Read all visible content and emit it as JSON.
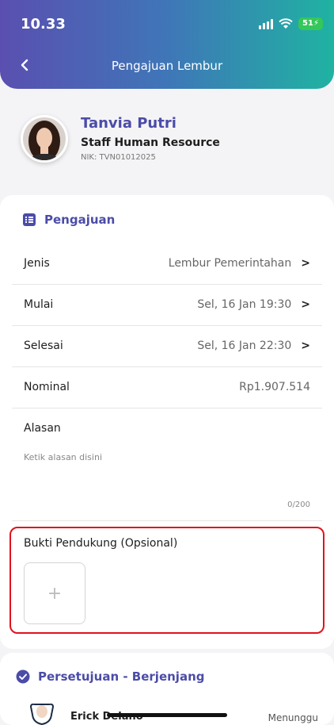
{
  "status": {
    "time": "10.33",
    "battery": "51"
  },
  "header": {
    "title": "Pengajuan Lembur"
  },
  "profile": {
    "name": "Tanvia Putri",
    "role": "Staff Human Resource",
    "nik": "NIK: TVN01012025"
  },
  "pengajuan": {
    "title": "Pengajuan",
    "rows": [
      {
        "label": "Jenis",
        "value": "Lembur Pemerintahan"
      },
      {
        "label": "Mulai",
        "value": "Sel, 16 Jan 19:30"
      },
      {
        "label": "Selesai",
        "value": "Sel, 16 Jan 22:30"
      },
      {
        "label": "Nominal",
        "value": "Rp1.907.514"
      }
    ],
    "alasan": {
      "label": "Alasan",
      "placeholder": "Ketik alasan disini",
      "counter": "0/200"
    },
    "bukti": {
      "label": "Bukti Pendukung (Opsional)",
      "add": "+"
    }
  },
  "persetujuan": {
    "title": "Persetujuan - Berjenjang",
    "approver": {
      "name": "Erick Delano",
      "status": "Menunggu"
    }
  },
  "icons": [
    "back-arrow-icon",
    "signal-icon",
    "wifi-icon",
    "battery-icon",
    "list-icon",
    "check-circle-icon",
    "chevron-right-icon",
    "plus-icon"
  ],
  "colors": {
    "accent": "#4b4ca8",
    "header_start": "#5a4fb0",
    "header_end": "#1fb3a2",
    "highlight": "#e1131d"
  }
}
